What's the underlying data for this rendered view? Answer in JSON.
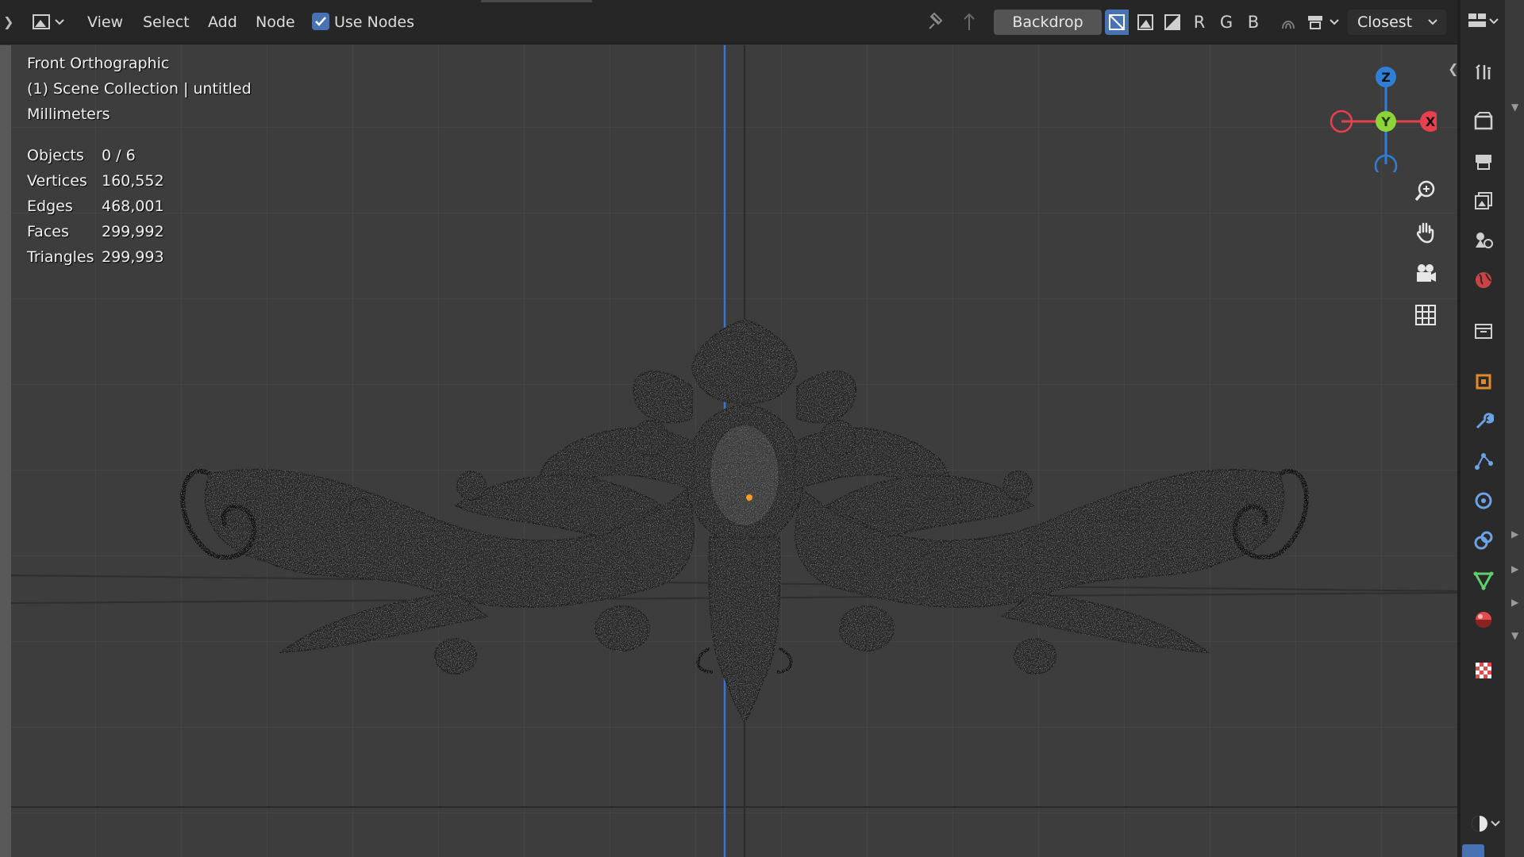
{
  "header": {
    "menus": [
      "View",
      "Select",
      "Add",
      "Node"
    ],
    "use_nodes_label": "Use Nodes",
    "use_nodes_checked": true,
    "backdrop_label": "Backdrop",
    "channels": [
      "R",
      "G",
      "B"
    ],
    "sampling_label": "Closest"
  },
  "viewport": {
    "view_name": "Front Orthographic",
    "collection": "(1) Scene Collection | untitled",
    "units": "Millimeters",
    "stats": [
      {
        "label": "Objects",
        "value": "0 / 6"
      },
      {
        "label": "Vertices",
        "value": "160,552"
      },
      {
        "label": "Edges",
        "value": "468,001"
      },
      {
        "label": "Faces",
        "value": "299,992"
      },
      {
        "label": "Triangles",
        "value": "299,993"
      }
    ]
  },
  "gizmo": {
    "axes": [
      "Z",
      "Y",
      "X"
    ],
    "colors": {
      "x": "#e8404f",
      "y": "#8dd43b",
      "z": "#2f7fd6"
    }
  },
  "nav_buttons": [
    "zoom-icon",
    "hand-pan-icon",
    "camera-icon",
    "grid-ortho-icon"
  ],
  "properties_tabs": [
    "tool-icon",
    "render-icon",
    "output-icon",
    "view-layer-icon",
    "scene-icon",
    "world-icon",
    "collection-icon",
    "object-icon",
    "modifier-icon",
    "particles-icon",
    "physics-icon",
    "constraints-icon",
    "data-icon",
    "material-icon",
    "texture-icon"
  ],
  "colors": {
    "header_bg": "#262626",
    "viewport_bg": "#3d3d3d",
    "accent": "#4772b3",
    "y_axis_line": "#3f76c4"
  }
}
